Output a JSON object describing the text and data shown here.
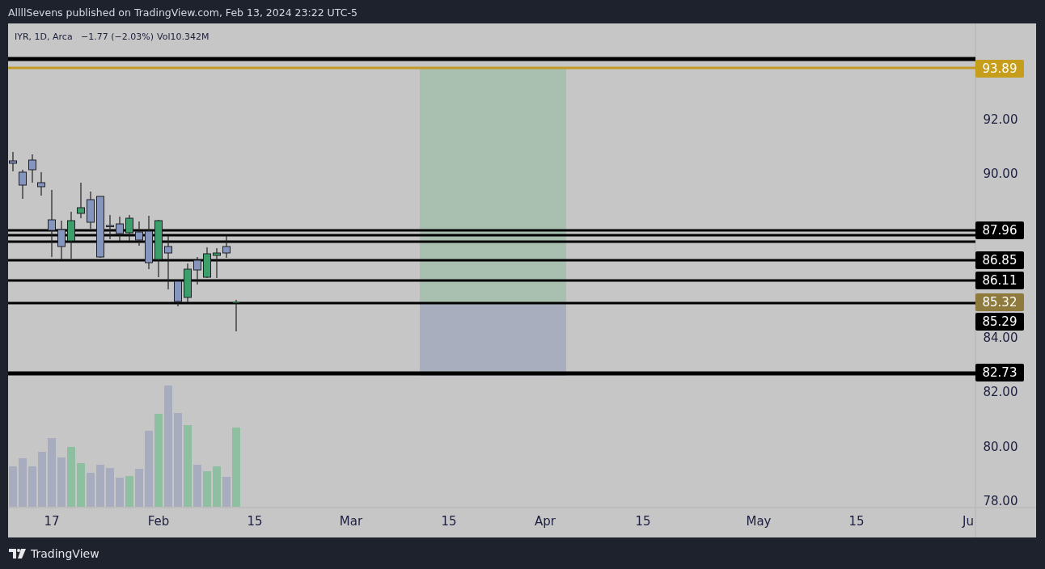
{
  "header": {
    "text": "AllllSevens published on TradingView.com, Feb 13, 2024 23:22 UTC-5"
  },
  "legend": [
    "IYR, 1D, Arca",
    "−1.77 (−2.03%)",
    "Vol10.342M"
  ],
  "price_labels": [
    {
      "text": "93.89",
      "kind": "gold"
    },
    {
      "text": "87.96",
      "kind": "black"
    },
    {
      "text": "86.85",
      "kind": "black"
    },
    {
      "text": "86.11",
      "kind": "black"
    },
    {
      "text": "85.32",
      "kind": "bronze"
    },
    {
      "text": "85.29",
      "kind": "black"
    },
    {
      "text": "82.73",
      "kind": "black"
    }
  ],
  "y_ticks": [
    "92.00",
    "90.00",
    "84.00",
    "82.00",
    "80.00",
    "78.00"
  ],
  "x_ticks": [
    "17",
    "Feb",
    "15",
    "Mar",
    "15",
    "Apr",
    "15",
    "May",
    "15",
    "Ju"
  ],
  "footer": {
    "brand": "TradingView"
  }
}
